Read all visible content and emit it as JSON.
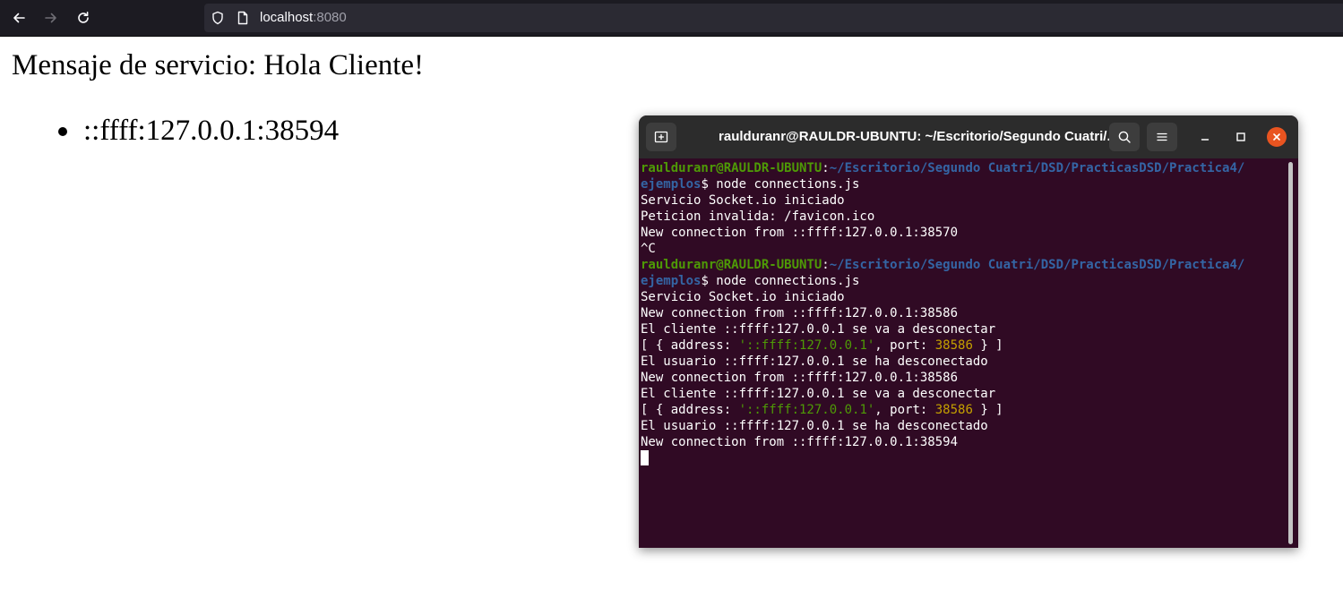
{
  "browser": {
    "url_host": "localhost",
    "url_port": ":8080"
  },
  "page": {
    "heading": "Mensaje de servicio: Hola Cliente!",
    "clients": [
      "::ffff:127.0.0.1:38594"
    ]
  },
  "terminal": {
    "title": "raulduranr@RAULDR-UBUNTU: ~/Escritorio/Segundo Cuatri/...",
    "prompt_user": "raulduranr@RAULDR-UBUNTU",
    "prompt_sep": ":",
    "prompt_path_1": "~/Escritorio/Segundo Cuatri/DSD/PracticasDSD/Practica4/",
    "prompt_path_2": "ejemplos",
    "prompt_cmd": "$ node connections.js",
    "lines": {
      "l3": "Servicio Socket.io iniciado",
      "l4": "Peticion invalida: /favicon.ico",
      "l5": "New connection from ::ffff:127.0.0.1:38570",
      "l6": "^C",
      "l9": "Servicio Socket.io iniciado",
      "l10": "New connection from ::ffff:127.0.0.1:38586",
      "l11": "El cliente ::ffff:127.0.0.1 se va a desconectar",
      "l13": "El usuario ::ffff:127.0.0.1 se ha desconectado",
      "l14": "New connection from ::ffff:127.0.0.1:38586",
      "l15": "El cliente ::ffff:127.0.0.1 se va a desconectar",
      "l17": "El usuario ::ffff:127.0.0.1 se ha desconectado",
      "l18": "New connection from ::ffff:127.0.0.1:38594"
    },
    "obj_open": "[ { address: ",
    "obj_address": "'::ffff:127.0.0.1'",
    "obj_port_key": ", port: ",
    "obj_port": "38586",
    "obj_close": " } ]"
  },
  "icons": {
    "back": "arrow-left-icon",
    "forward": "arrow-right-icon",
    "reload": "reload-icon",
    "shield": "shield-icon",
    "page": "page-icon",
    "new_tab": "new-tab-icon",
    "search": "search-icon",
    "menu": "hamburger-menu-icon",
    "minimize": "minimize-icon",
    "maximize": "maximize-icon",
    "close": "close-icon"
  },
  "colors": {
    "terminal_bg": "#300a24",
    "prompt_user": "#4e9a06",
    "prompt_path": "#3465a4",
    "string": "#4e9a06",
    "number": "#c4a000",
    "close_button": "#e95420"
  }
}
